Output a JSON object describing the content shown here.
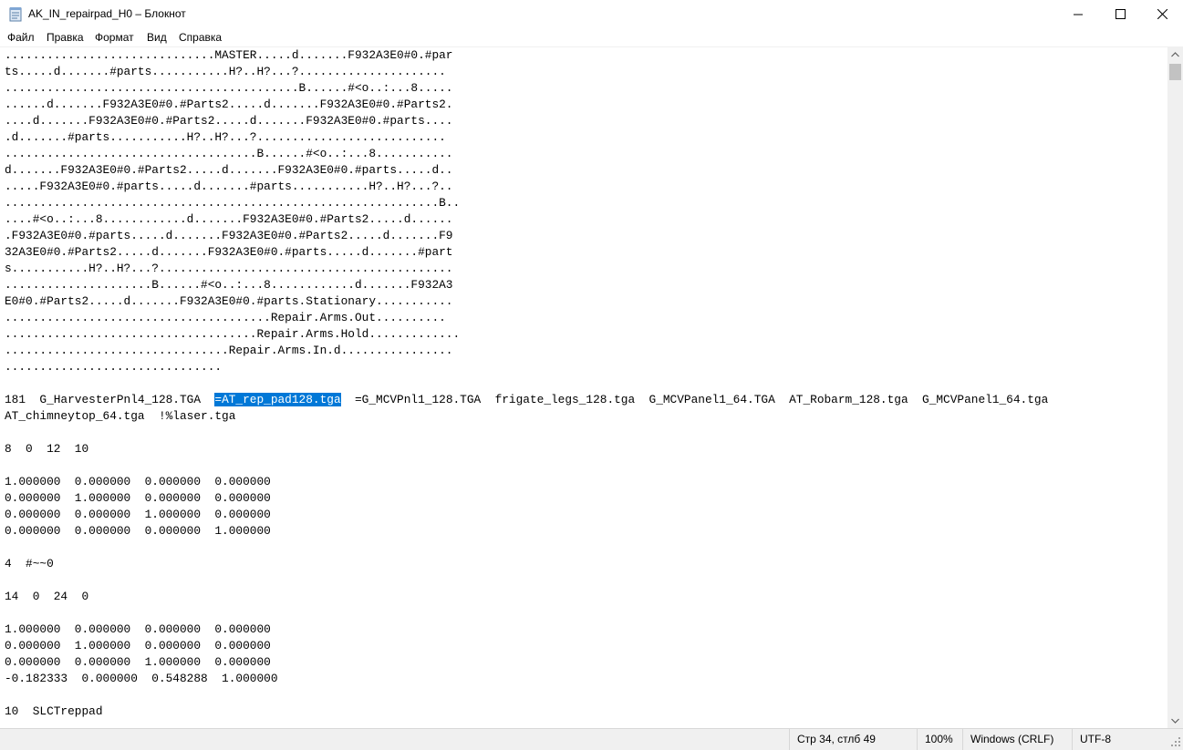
{
  "window": {
    "title": "AK_IN_repairpad_H0 – Блокнот",
    "minimize_glyph": "—",
    "maximize_glyph": "☐",
    "close_glyph": "✕"
  },
  "menu": [
    "Файл",
    "Правка",
    "Формат",
    "Вид",
    "Справка"
  ],
  "editor": {
    "lines": [
      "..............................MASTER.....d.......F932A3E0#0.#par",
      "ts.....d.......#parts...........H?..H?...?.....................",
      "..........................................B......#<o..:...8.....",
      "......d.......F932A3E0#0.#Parts2.....d.......F932A3E0#0.#Parts2.",
      "....d.......F932A3E0#0.#Parts2.....d.......F932A3E0#0.#parts....",
      ".d.......#parts...........H?..H?...?...........................",
      "....................................B......#<o..:...8...........",
      "d.......F932A3E0#0.#Parts2.....d.......F932A3E0#0.#parts.....d..",
      ".....F932A3E0#0.#parts.....d.......#parts...........H?..H?...?..",
      "..............................................................B..",
      "....#<o..:...8............d.......F932A3E0#0.#Parts2.....d......",
      ".F932A3E0#0.#parts.....d.......F932A3E0#0.#Parts2.....d.......F9",
      "32A3E0#0.#Parts2.....d.......F932A3E0#0.#parts.....d.......#part",
      "s...........H?..H?...?..........................................",
      ".....................B......#<o..:...8............d.......F932A3",
      "E0#0.#Parts2.....d.......F932A3E0#0.#parts.Stationary...........",
      "......................................Repair.Arms.Out..........",
      "....................................Repair.Arms.Hold.............",
      "................................Repair.Arms.In.d................",
      "..............................."
    ],
    "texture_line": {
      "before": "181  G_HarvesterPnl4_128.TGA  ",
      "selected": "=AT_rep_pad128.tga",
      "after": "  =G_MCVPnl1_128.TGA  frigate_legs_128.tga  G_MCVPanel1_64.TGA  AT_Robarm_128.tga  G_MCVPanel1_64.tga"
    },
    "lines_after": [
      "AT_chimneytop_64.tga  !%laser.tga",
      "",
      "8  0  12  10",
      "",
      "1.000000  0.000000  0.000000  0.000000",
      "0.000000  1.000000  0.000000  0.000000",
      "0.000000  0.000000  1.000000  0.000000",
      "0.000000  0.000000  0.000000  1.000000",
      "",
      "4  #~~0",
      "",
      "14  0  24  0",
      "",
      "1.000000  0.000000  0.000000  0.000000",
      "0.000000  1.000000  0.000000  0.000000",
      "0.000000  0.000000  1.000000  0.000000",
      "-0.182333  0.000000  0.548288  1.000000",
      "",
      "10  SLCTreppad"
    ]
  },
  "status": {
    "position": "Стр 34, стлб 49",
    "zoom": "100%",
    "line_ending": "Windows (CRLF)",
    "encoding": "UTF-8"
  },
  "colors": {
    "selection": "#0078d7",
    "statusbar_bg": "#f0f0f0"
  }
}
